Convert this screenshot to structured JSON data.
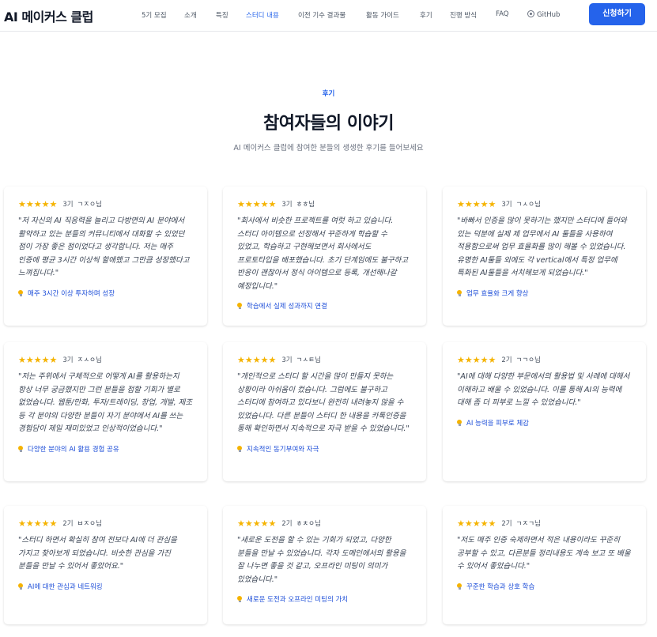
{
  "nav": {
    "brand": "AI 메이커스 클럽",
    "links": [
      "5기 모집",
      "소개",
      "특징",
      "스터디 내용",
      "이전 기수 결과물",
      "활동 가이드",
      "후기",
      "진행 방식",
      "FAQ",
      "GitHub"
    ],
    "active_index": 3,
    "cta": "신청하기"
  },
  "section": {
    "eyebrow": "후기",
    "title": "참여자들의 이야기",
    "subtitle": "AI 메이커스 클럽에 참여한 분들의 생생한 후기를 들어보세요"
  },
  "reviews": [
    {
      "stars": "★★★★★",
      "rating": 5,
      "cohort": "3기",
      "author": "ㄱㅈㅇ님",
      "quote": "\"저 자신의 AI 직응력을 늘리고 다방면의 AI 분야에서 활약하고 있는 분들의 커뮤니티에서 대화할 수 있었던 점이 가장 좋은 점이었다고 생각합니다. 저는 매주 인증에 평균 3시간 이상씩 할애했고 그만큼 성장했다고 느껴집니다.\"",
      "highlight": "매주 3시간 이상 투자하며 성장"
    },
    {
      "stars": "★★★★★",
      "rating": 5,
      "cohort": "3기",
      "author": "ㅎㅎ님",
      "quote": "\"회사에서 비슷한 프로젝트를 여럿 하고 있습니다. 스터디 아이템으로 선정해서 꾸준하게 학습할 수 있었고, 학습하고 구현해보면서 회사에서도 프로토타입을 배포했습니다. 초기 단계임에도 불구하고 반응이 괜찮아서 정식 아이템으로 등록, 개선해나갈 예정입니다.\"",
      "highlight": "학습에서 실제 성과까지 연결"
    },
    {
      "stars": "★★★★★",
      "rating": 5,
      "cohort": "3기",
      "author": "ㄱㅅㅇ님",
      "quote": "\"바빠서 인증을 많이 못하기는 했지만 스터디에 들어와 있는 덕분에 실제 제 업무에서 AI 툴들을 사용하여 적용함으로써 업무 효율화를 많이 해볼 수 있었습니다. 유명한 AI툴들 외에도 각 vertical에서 특정 업무에 특화된 AI툴들을 서치해보게 되었습니다.\"",
      "highlight": "업무 효율화 크게 향상"
    },
    {
      "stars": "★★★★★",
      "rating": 5,
      "cohort": "3기",
      "author": "ㅈㅅㅇ님",
      "quote": "\"저는 주위에서 구체적으로 어떻게 AI를 활용하는지 항상 너무 궁금했지만 그런 분들을 접할 기회가 별로 없었습니다. 웹툰/만화, 투자/트레이딩, 창업, 개발, 제조 등 각 분야의 다양한 분들이 자기 분야에서 AI를 쓰는 경험담이 제일 재미있었고 인상적이었습니다.\"",
      "highlight": "다양한 분야의 AI 활용 경험 공유"
    },
    {
      "stars": "★★★★★",
      "rating": 5,
      "cohort": "3기",
      "author": "ㄱㅅㅌ님",
      "quote": "\"개인적으로 스터디 할 시간을 많이 만들지 못하는 상황이라 아쉬움이 컸습니다. 그럼에도 불구하고 스터디에 참여하고 있다보니 완전히 내려놓지 않을 수 있었습니다. 다른 분들이 스터디 한 내용을 카톡인증을 통해 확인하면서 지속적으로 자극 받을 수 있었습니다.\"",
      "highlight": "지속적인 동기부여와 자극"
    },
    {
      "stars": "★★★★★",
      "rating": 5,
      "cohort": "2기",
      "author": "ㄱㄱㅇ님",
      "quote": "\"AI에 대해 다양한 부문에서의 활용법 및 사례에 대해서 이해하고 배울 수 있었습니다. 이를 통해 AI의 능력에 대해 좀 더 피부로 느낄 수 있었습니다.\"",
      "highlight": "AI 능력을 피부로 체감"
    },
    {
      "stars": "★★★★★",
      "rating": 5,
      "cohort": "2기",
      "author": "ㅂㅈㅇ님",
      "quote": "\"스터디 하면서 확실히 참여 전보다 AI에 더 관심을 가지고 찾아보게 되었습니다. 비슷한 관심을 가진 분들을 만날 수 있어서 좋았어요.\"",
      "highlight": "AI에 대한 관심과 네트워킹"
    },
    {
      "stars": "★★★★★",
      "rating": 5,
      "cohort": "2기",
      "author": "ㅎㅊㅇ님",
      "quote": "\"새로운 도전을 할 수 있는 기회가 되었고, 다양한 분들을 만날 수 있었습니다. 각자 도메인에서의 활용을 잘 나누면 좋을 것 같고, 오프라인 미팅이 의미가 있었습니다.\"",
      "highlight": "새로운 도전과 오프라인 미팅의 가치"
    },
    {
      "stars": "★★★★★",
      "rating": 5,
      "cohort": "2기",
      "author": "ㄱㅈㄱ님",
      "quote": "\"저도 매주 인증 숙제하면서 적은 내용이라도 꾸준히 공부할 수 있고, 다른분들 정리내용도 계속 보고 또 배울 수 있어서 좋았습니다.\"",
      "highlight": "꾸준한 학습과 상호 학습"
    }
  ]
}
